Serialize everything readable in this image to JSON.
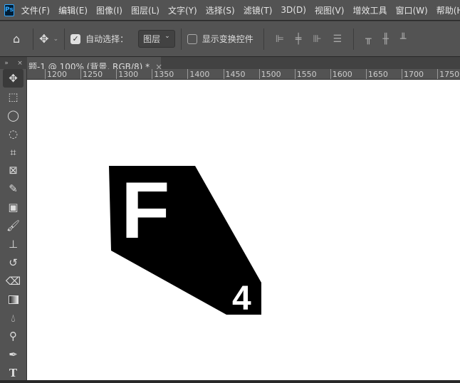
{
  "menubar": {
    "logo": "Ps",
    "items": [
      "文件(F)",
      "编辑(E)",
      "图像(I)",
      "图层(L)",
      "文字(Y)",
      "选择(S)",
      "滤镜(T)",
      "3D(D)",
      "视图(V)",
      "增效工具",
      "窗口(W)",
      "帮助(H)"
    ]
  },
  "options": {
    "auto_select_label": "自动选择：",
    "auto_select_checked": true,
    "target_value": "图层",
    "show_transform_label": "显示变换控件",
    "show_transform_checked": false
  },
  "document_tab": {
    "title": "题-1 @ 100% (背景, RGB/8) *",
    "close": "×"
  },
  "ruler": {
    "labels": [
      "1200",
      "1250",
      "1300",
      "1350",
      "1400",
      "1450",
      "1500",
      "1550",
      "1600",
      "1650",
      "1700",
      "1750"
    ]
  },
  "tools": [
    "move",
    "rectangular-marquee",
    "lasso",
    "quick-selection",
    "crop",
    "frame",
    "eyedropper",
    "spot-healing",
    "brush",
    "clone-stamp",
    "history-brush",
    "eraser",
    "gradient",
    "blur",
    "dodge",
    "pen",
    "type"
  ],
  "canvas": {
    "letter": "F",
    "number": "4",
    "shape_color": "#000000"
  }
}
